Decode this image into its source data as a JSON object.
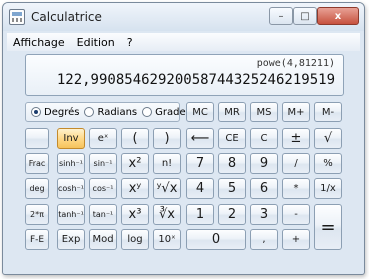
{
  "window": {
    "title": "Calculatrice",
    "minimize": "–",
    "maximize": "□",
    "close": "x"
  },
  "menu": [
    "Affichage",
    "Edition",
    "?"
  ],
  "display": {
    "expression": "powe(4,81211)",
    "result": "122,9908546292005874432524621951​9"
  },
  "angles": [
    {
      "label": "Degrés",
      "selected": true
    },
    {
      "label": "Radians",
      "selected": false
    },
    {
      "label": "Grades",
      "selected": false
    }
  ],
  "keys": {
    "mc": "MC",
    "mr": "MR",
    "ms": "MS",
    "mplus": "M+",
    "mminus": "M-",
    "inv": "Inv",
    "ex": "eˣ",
    "lparen": "(",
    "rparen": ")",
    "back": "⟵",
    "ce": "CE",
    "c": "C",
    "pm": "±",
    "sqrt": "√",
    "frac": "Frac",
    "sinh_inv": "sinh⁻¹",
    "sin_inv": "sin⁻¹",
    "x2": "x²",
    "fact": "n!",
    "k7": "7",
    "k8": "8",
    "k9": "9",
    "div": "/",
    "pct": "%",
    "deg": "deg",
    "cosh_inv": "cosh⁻¹",
    "cos_inv": "cos⁻¹",
    "xy": "xʸ",
    "yroot": "ʸ√x",
    "k4": "4",
    "k5": "5",
    "k6": "6",
    "mul": "*",
    "recip": "1/x",
    "twopi": "2*π",
    "tanh_inv": "tanh⁻¹",
    "tan_inv": "tan⁻¹",
    "x3": "x³",
    "croot": "∛x",
    "k1": "1",
    "k2": "2",
    "k3": "3",
    "sub": "-",
    "eq": "=",
    "fe": "F-E",
    "exp": "Exp",
    "mod": "Mod",
    "log": "log",
    "tenx": "10ˣ",
    "k0": "0",
    "dot": ",",
    "add": "+"
  },
  "colors": {
    "active_key": "#f6c35c",
    "window_bg": "#dde7f2"
  }
}
